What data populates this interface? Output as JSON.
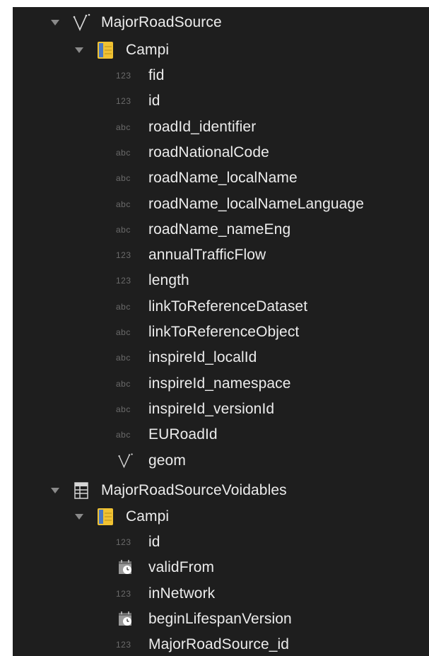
{
  "tree": {
    "layer1": {
      "name": "MajorRoadSource",
      "icon": "line-geometry-icon",
      "fields_group": "Campi",
      "fields": [
        {
          "badge": "123",
          "name": "fid"
        },
        {
          "badge": "123",
          "name": "id"
        },
        {
          "badge": "abc",
          "name": "roadId_identifier"
        },
        {
          "badge": "abc",
          "name": "roadNationalCode"
        },
        {
          "badge": "abc",
          "name": "roadName_localName"
        },
        {
          "badge": "abc",
          "name": "roadName_localNameLanguage"
        },
        {
          "badge": "abc",
          "name": "roadName_nameEng"
        },
        {
          "badge": "123",
          "name": "annualTrafficFlow"
        },
        {
          "badge": "123",
          "name": "length"
        },
        {
          "badge": "abc",
          "name": "linkToReferenceDataset"
        },
        {
          "badge": "abc",
          "name": "linkToReferenceObject"
        },
        {
          "badge": "abc",
          "name": "inspireId_localId"
        },
        {
          "badge": "abc",
          "name": "inspireId_namespace"
        },
        {
          "badge": "abc",
          "name": "inspireId_versionId"
        },
        {
          "badge": "abc",
          "name": "EURoadId"
        },
        {
          "badge": "",
          "name": "geom",
          "icon": "line-geometry-icon"
        }
      ]
    },
    "layer2": {
      "name": "MajorRoadSourceVoidables",
      "icon": "table-icon",
      "fields_group": "Campi",
      "fields": [
        {
          "badge": "123",
          "name": "id"
        },
        {
          "badge": "",
          "name": "validFrom",
          "icon": "datetime-icon"
        },
        {
          "badge": "123",
          "name": "inNetwork"
        },
        {
          "badge": "",
          "name": "beginLifespanVersion",
          "icon": "datetime-icon"
        },
        {
          "badge": "123",
          "name": "MajorRoadSource_id"
        }
      ]
    }
  },
  "colors": {
    "background": "#1e1e1e",
    "text": "#ececec",
    "badge": "#6b6b6b",
    "arrow": "#8a8a8a",
    "layer_icon_yellow": "#f1c232",
    "layer_icon_blue": "#4a78c2"
  }
}
